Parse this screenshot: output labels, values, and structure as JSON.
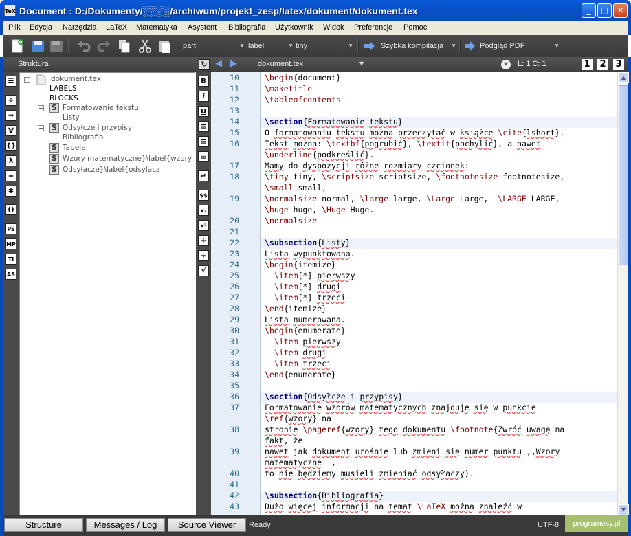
{
  "window": {
    "title": "Document : D:/Dokumenty/░░░░/archiwum/projekt_zesp/latex/dokument/dokument.tex",
    "icon": "TeX",
    "minimize": "_",
    "maximize": "□",
    "close": "✕"
  },
  "menu": [
    "Plik",
    "Edycja",
    "Narzędzia",
    "LaTeX",
    "Matematyka",
    "Asystent",
    "Bibliografia",
    "Użytkownik",
    "Widok",
    "Preferencje",
    "Pomoc"
  ],
  "toolbar": {
    "combo_part": "part",
    "combo_label": "label",
    "combo_tiny": "tiny",
    "quick_build": "Szybka kompilacja",
    "preview": "Podgląd PDF"
  },
  "structure": {
    "header": "Struktura",
    "root": "dokument.tex",
    "labels": "LABELS",
    "blocks": "BLOCKS",
    "sections": [
      {
        "label": "Formatowanie tekstu",
        "sub": [
          "Listy"
        ]
      },
      {
        "label": "Odsyłcze i przypisy",
        "sub": [
          "Bibliografia"
        ]
      },
      {
        "label": "Tabele",
        "sub": []
      },
      {
        "label": "Wzory matematyczne}\\label{wzory",
        "sub": []
      },
      {
        "label": "Odsyłacze}\\label{odsylacz",
        "sub": []
      }
    ]
  },
  "editor": {
    "tab": "dokument.tex",
    "cursor": "L: 1 C: 1",
    "views": [
      "1",
      "2",
      "3"
    ]
  },
  "status": {
    "structure_btn": "Structure",
    "messages_btn": "Messages / Log",
    "source_btn": "Source Viewer",
    "state": "Ready",
    "encoding": "UTF-8",
    "watermark": "programosy.pl"
  },
  "code_lines": [
    {
      "n": "10",
      "t": "\\begin{document}"
    },
    {
      "n": "11",
      "t": "\\maketitle"
    },
    {
      "n": "12",
      "t": "\\tableofcontents"
    },
    {
      "n": "13",
      "t": ""
    },
    {
      "n": "14",
      "t": "\\section{Formatowanie tekstu}"
    },
    {
      "n": "15",
      "t": "O formatowaniu tekstu można przeczytać w książce \\cite{lshort}."
    },
    {
      "n": "16",
      "t": "Tekst można: \\textbf{pogrubić}, \\textit{pochylić}, a nawet"
    },
    {
      "n": "",
      "t": "\\underline{podkreślić}."
    },
    {
      "n": "17",
      "t": "Mamy do dyspozycji różne rozmiary czcionek:"
    },
    {
      "n": "18",
      "t": "\\tiny tiny, \\scriptsize scriptsize, \\footnotesize footnotesize,"
    },
    {
      "n": "",
      "t": "\\small small,"
    },
    {
      "n": "19",
      "t": "\\normalsize normal, \\large large, \\Large Large,  \\LARGE LARGE,"
    },
    {
      "n": "",
      "t": "\\huge huge, \\Huge Huge."
    },
    {
      "n": "20",
      "t": "\\normalsize"
    },
    {
      "n": "21",
      "t": ""
    },
    {
      "n": "22",
      "t": "\\subsection{Listy}"
    },
    {
      "n": "23",
      "t": "Lista wypunktowana."
    },
    {
      "n": "24",
      "t": "\\begin{itemize}"
    },
    {
      "n": "25",
      "t": "  \\item[*] pierwszy"
    },
    {
      "n": "26",
      "t": "  \\item[*] drugi"
    },
    {
      "n": "27",
      "t": "  \\item[*] trzeci"
    },
    {
      "n": "28",
      "t": "\\end{itemize}"
    },
    {
      "n": "29",
      "t": "Lista numerowana."
    },
    {
      "n": "30",
      "t": "\\begin{enumerate}"
    },
    {
      "n": "31",
      "t": "  \\item pierwszy"
    },
    {
      "n": "32",
      "t": "  \\item drugi"
    },
    {
      "n": "33",
      "t": "  \\item trzeci"
    },
    {
      "n": "34",
      "t": "\\end{enumerate}"
    },
    {
      "n": "35",
      "t": ""
    },
    {
      "n": "36",
      "t": "\\section{Odsyłcze i przypisy}"
    },
    {
      "n": "37",
      "t": "Formatowanie wzorów matematycznych znajduje się w punkcie"
    },
    {
      "n": "",
      "t": "\\ref{wzory} na"
    },
    {
      "n": "38",
      "t": "stronie \\pageref{wzory} tego dokumentu \\footnote{Zwróć uwagę na"
    },
    {
      "n": "",
      "t": "fakt, że"
    },
    {
      "n": "39",
      "t": "nawet jak dokument urośnie lub zmieni się numer punktu ,,Wzory"
    },
    {
      "n": "",
      "t": "matematyczne'',"
    },
    {
      "n": "40",
      "t": "to nie będziemy musieli zmieniać odsyłaczy)."
    },
    {
      "n": "41",
      "t": ""
    },
    {
      "n": "42",
      "t": "\\subsection{Bibliografia}"
    },
    {
      "n": "43",
      "t": "Dużo więcej informacji na temat \\LaTeX można znaleźć w"
    }
  ]
}
